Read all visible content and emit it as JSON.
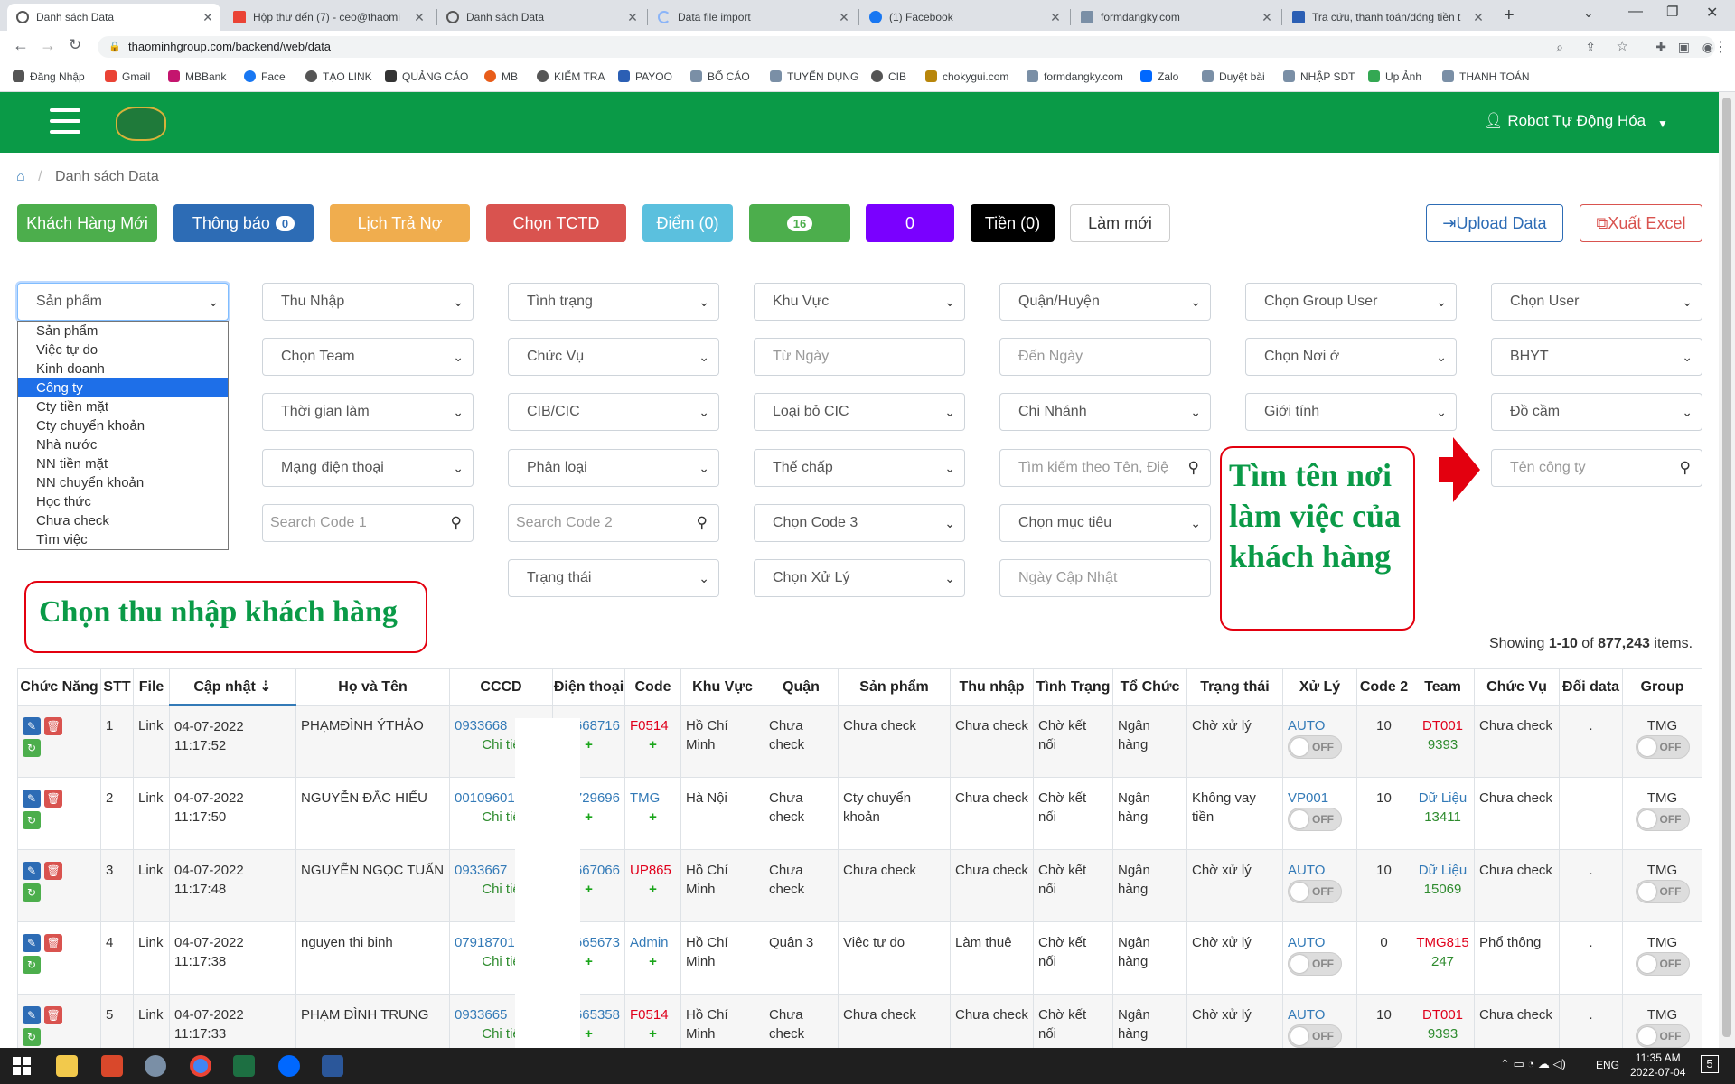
{
  "browser": {
    "tabs": [
      {
        "title": "Danh sách Data",
        "active": true
      },
      {
        "title": "Hộp thư đến (7) - ceo@thaomi"
      },
      {
        "title": "Danh sách Data"
      },
      {
        "title": "Data file import"
      },
      {
        "title": "(1) Facebook"
      },
      {
        "title": "formdangky.com"
      },
      {
        "title": "Tra cứu, thanh toán/đóng tiền t"
      }
    ],
    "url": "thaominhgroup.com/backend/web/data",
    "bookmarks": [
      "Đăng Nhập",
      "Gmail",
      "MBBank",
      "Face",
      "TẠO LINK",
      "QUẢNG CÁO",
      "MB",
      "KIỂM TRA",
      "PAYOO",
      "BỐ CÁO",
      "TUYỂN DỤNG",
      "CIB",
      "chokygui.com",
      "formdangky.com",
      "Zalo",
      "Duyệt bài",
      "NHẬP SDT",
      "Up Ảnh",
      "THANH TOÁN"
    ]
  },
  "header": {
    "user": "Robot Tự Động Hóa"
  },
  "breadcrumb": {
    "current": "Danh sách Data"
  },
  "toolbar": {
    "new_customer": "Khách Hàng Mới",
    "notify": "Thông báo",
    "notify_count": "0",
    "debt": "Lịch Trả Nợ",
    "tctd": "Chọn TCTD",
    "points": "Điểm (0)",
    "green_count": "16",
    "purple_count": "0",
    "money": "Tiền (0)",
    "refresh": "Làm mới",
    "upload": "Upload Data",
    "export": "Xuất Excel"
  },
  "colors": {
    "header_green": "#0a9a47",
    "accent_red": "#e3000f"
  },
  "filters": {
    "row1": [
      "Sản phẩm",
      "Thu Nhập",
      "Tình trạng",
      "Khu Vực",
      "Quận/Huyện",
      "Chọn Group User",
      "Chọn User"
    ],
    "row2": [
      "Chọn Team",
      "Chức Vụ",
      "Từ Ngày",
      "Đến Ngày",
      "Chọn Nơi ở",
      "BHYT"
    ],
    "row3": [
      "Thời gian làm",
      "CIB/CIC",
      "Loại bỏ CIC",
      "Chi Nhánh",
      "Giới tính",
      "Đồ cầm"
    ],
    "row4": [
      "Mạng điện thoại",
      "Phân loại",
      "Thế chấp",
      "Tìm kiếm theo Tên, Điệ",
      "Tên công ty"
    ],
    "row5": [
      "Search Code 1",
      "Search Code 2",
      "Chọn Code 3",
      "Chọn mục tiêu"
    ],
    "row6": [
      "Trạng thái",
      "Chọn Xử Lý",
      "Ngày Cập Nhật"
    ]
  },
  "dropdown_options": [
    "Sản phẩm",
    "Việc tự do",
    "Kinh doanh",
    "Công ty",
    "Cty tiền mặt",
    "Cty chuyển khoản",
    "Nhà nước",
    "NN tiền mặt",
    "NN chuyển khoản",
    "Học thức",
    "Chưa check",
    "Tìm việc"
  ],
  "dropdown_highlighted": "Công ty",
  "annotations": {
    "income": "Chọn thu nhập khách hàng",
    "workplace": "Tìm tên nơi làm việc của khách hàng"
  },
  "summary": {
    "prefix": "Showing ",
    "range": "1-10",
    "mid": " of ",
    "total": "877,243",
    "suffix": " items."
  },
  "table": {
    "columns": [
      "Chức Năng",
      "STT",
      "File",
      "Cập nhật",
      "Họ và Tên",
      "CCCD",
      "Điện thoại",
      "Code",
      "Khu Vực",
      "Quận",
      "Sản phẩm",
      "Thu nhập",
      "Tình Trạng",
      "Tổ Chức",
      "Trạng thái",
      "Xử Lý",
      "Code 2",
      "Team",
      "Chức Vụ",
      "Đối data",
      "Group"
    ],
    "detail_label": "Chi tiế",
    "toggle_label": "OFF",
    "rows": [
      {
        "stt": "1",
        "file": "Link",
        "date": "04-07-2022",
        "time": "11:17:52",
        "name": "PHẠMĐÌNH ÝTHẢO",
        "cccd": "0933668",
        "phone": "3668716",
        "code": "F0514",
        "area": "Hồ Chí Minh",
        "district": "Chưa check",
        "product": "Chưa check",
        "income": "Chưa check",
        "status": "Chờ kết nối",
        "org": "Ngân hàng",
        "state": "Chờ xử lý",
        "handler": "AUTO",
        "code2": "10",
        "team": "DT001",
        "team2": "9393",
        "position": "Chưa check",
        "swap": ".",
        "group": "TMG"
      },
      {
        "stt": "2",
        "file": "Link",
        "date": "04-07-2022",
        "time": "11:17:50",
        "name": "NGUYỄN ĐẮC HIẾU",
        "cccd": "00109601",
        "phone": "9729696",
        "code": "TMG",
        "area": "Hà Nội",
        "district": "Chưa check",
        "product": "Cty chuyển khoản",
        "income": "Chưa check",
        "status": "Chờ kết nối",
        "org": "Ngân hàng",
        "state": "Không vay tiền",
        "handler": "VP001",
        "code2": "10",
        "team": "Dữ Liệu",
        "team2": "13411",
        "position": "Chưa check",
        "swap": "",
        "group": "TMG"
      },
      {
        "stt": "3",
        "file": "Link",
        "date": "04-07-2022",
        "time": "11:17:48",
        "name": "NGUYỄN NGỌC TUẤN",
        "cccd": "0933667",
        "phone": "3667066",
        "code": "UP865",
        "area": "Hồ Chí Minh",
        "district": "Chưa check",
        "product": "Chưa check",
        "income": "Chưa check",
        "status": "Chờ kết nối",
        "org": "Ngân hàng",
        "state": "Chờ xử lý",
        "handler": "AUTO",
        "code2": "10",
        "team": "Dữ Liệu",
        "team2": "15069",
        "position": "Chưa check",
        "swap": ".",
        "group": "TMG"
      },
      {
        "stt": "4",
        "file": "Link",
        "date": "04-07-2022",
        "time": "11:17:38",
        "name": "nguyen thi binh",
        "cccd": "07918701",
        "phone": "3665673",
        "code": "Admin",
        "area": "Hồ Chí Minh",
        "district": "Quận 3",
        "product": "Việc tự do",
        "income": "Làm thuê",
        "status": "Chờ kết nối",
        "org": "Ngân hàng",
        "state": "Chờ xử lý",
        "handler": "AUTO",
        "code2": "0",
        "team": "TMG815",
        "team2": "247",
        "position": "Phổ thông",
        "swap": ".",
        "group": "TMG"
      },
      {
        "stt": "5",
        "file": "Link",
        "date": "04-07-2022",
        "time": "11:17:33",
        "name": "PHẠM ĐÌNH TRUNG",
        "cccd": "0933665",
        "phone": "3665358",
        "code": "F0514",
        "area": "Hồ Chí Minh",
        "district": "Chưa check",
        "product": "Chưa check",
        "income": "Chưa check",
        "status": "Chờ kết nối",
        "org": "Ngân hàng",
        "state": "Chờ xử lý",
        "handler": "AUTO",
        "code2": "10",
        "team": "DT001",
        "team2": "9393",
        "position": "Chưa check",
        "swap": ".",
        "group": "TMG"
      }
    ]
  },
  "taskbar": {
    "lang": "ENG",
    "time": "11:35 AM",
    "date": "2022-07-04",
    "notif": "5"
  }
}
